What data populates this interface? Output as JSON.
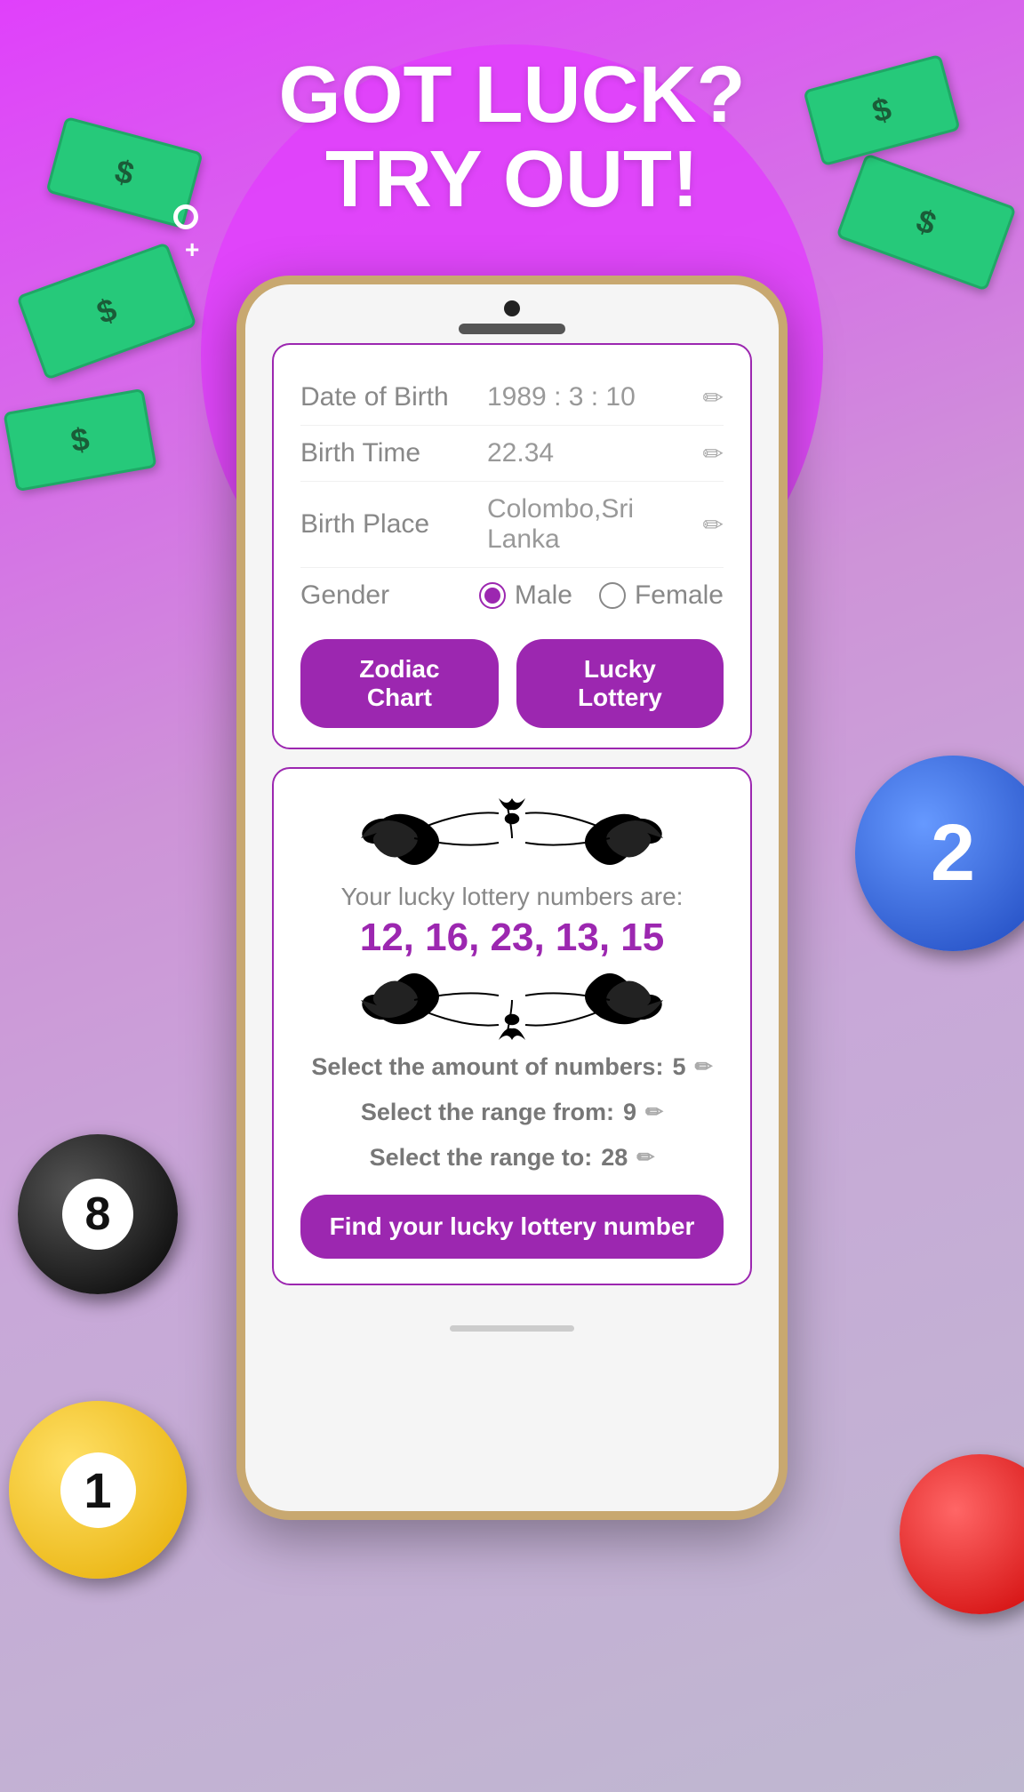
{
  "background": {
    "color1": "#e040fb",
    "color2": "#bfb8d0"
  },
  "header": {
    "line1": "GOT LUCK?",
    "line2": "TRY OUT!"
  },
  "phone": {
    "card1": {
      "fields": [
        {
          "label": "Date of Birth",
          "value": "1989 : 3 : 10"
        },
        {
          "label": "Birth Time",
          "value": "22.34"
        },
        {
          "label": "Birth Place",
          "value": "Colombo,Sri Lanka"
        }
      ],
      "gender": {
        "label": "Gender",
        "options": [
          "Male",
          "Female"
        ],
        "selected": "Male"
      },
      "buttons": [
        "Zodiac Chart",
        "Lucky Lottery"
      ]
    },
    "card2": {
      "subtitle": "Your lucky lottery numbers are:",
      "numbers": "12, 16, 23, 13, 15",
      "settings": [
        {
          "label": "Select the amount of numbers:",
          "value": "5"
        },
        {
          "label": "Select the range from:",
          "value": "9"
        },
        {
          "label": "Select the range to:",
          "value": "28"
        }
      ],
      "find_button": "Find your lucky lottery number"
    }
  },
  "icons": {
    "edit": "✏"
  }
}
